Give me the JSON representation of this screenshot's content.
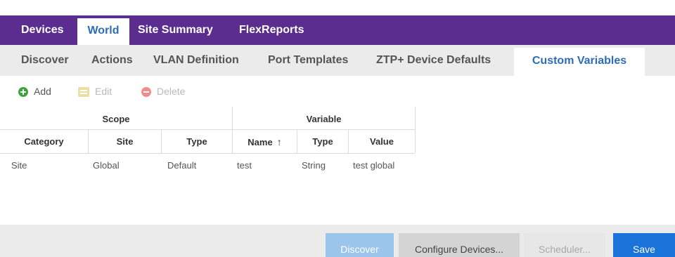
{
  "top_nav": {
    "tabs": [
      {
        "label": "Devices",
        "active": false
      },
      {
        "label": "World",
        "active": true
      },
      {
        "label": "Site Summary",
        "active": false
      },
      {
        "label": "FlexReports",
        "active": false
      }
    ]
  },
  "sub_nav": {
    "tabs": [
      {
        "label": "Discover",
        "active": false
      },
      {
        "label": "Actions",
        "active": false
      },
      {
        "label": "VLAN Definition",
        "active": false
      },
      {
        "label": "Port Templates",
        "active": false
      },
      {
        "label": "ZTP+ Device Defaults",
        "active": false
      },
      {
        "label": "Custom Variables",
        "active": true
      }
    ]
  },
  "toolbar": {
    "add_label": "Add",
    "edit_label": "Edit",
    "delete_label": "Delete",
    "add_icon": "add-circle-icon",
    "edit_icon": "edit-icon",
    "delete_icon": "delete-circle-icon"
  },
  "table": {
    "groups": [
      {
        "label": "Scope"
      },
      {
        "label": "Variable"
      }
    ],
    "columns": [
      {
        "label": "Category"
      },
      {
        "label": "Site"
      },
      {
        "label": "Type"
      },
      {
        "label": "Name",
        "sorted": "ascending",
        "sort_icon": "sort-up-arrow-icon"
      },
      {
        "label": "Type"
      },
      {
        "label": "Value"
      }
    ],
    "rows": [
      [
        "Site",
        "Global",
        "Default",
        "test",
        "String",
        "test global"
      ]
    ]
  },
  "footer": {
    "discover_label": "Discover",
    "configure_label": "Configure Devices...",
    "scheduler_label": "Scheduler...",
    "save_label": "Save"
  },
  "colors": {
    "top_nav_bg": "#5b2d8e",
    "active_tab_text": "#2d6db5",
    "save_button": "#1a73d9",
    "discover_button_disabled": "#9cc5ec"
  }
}
